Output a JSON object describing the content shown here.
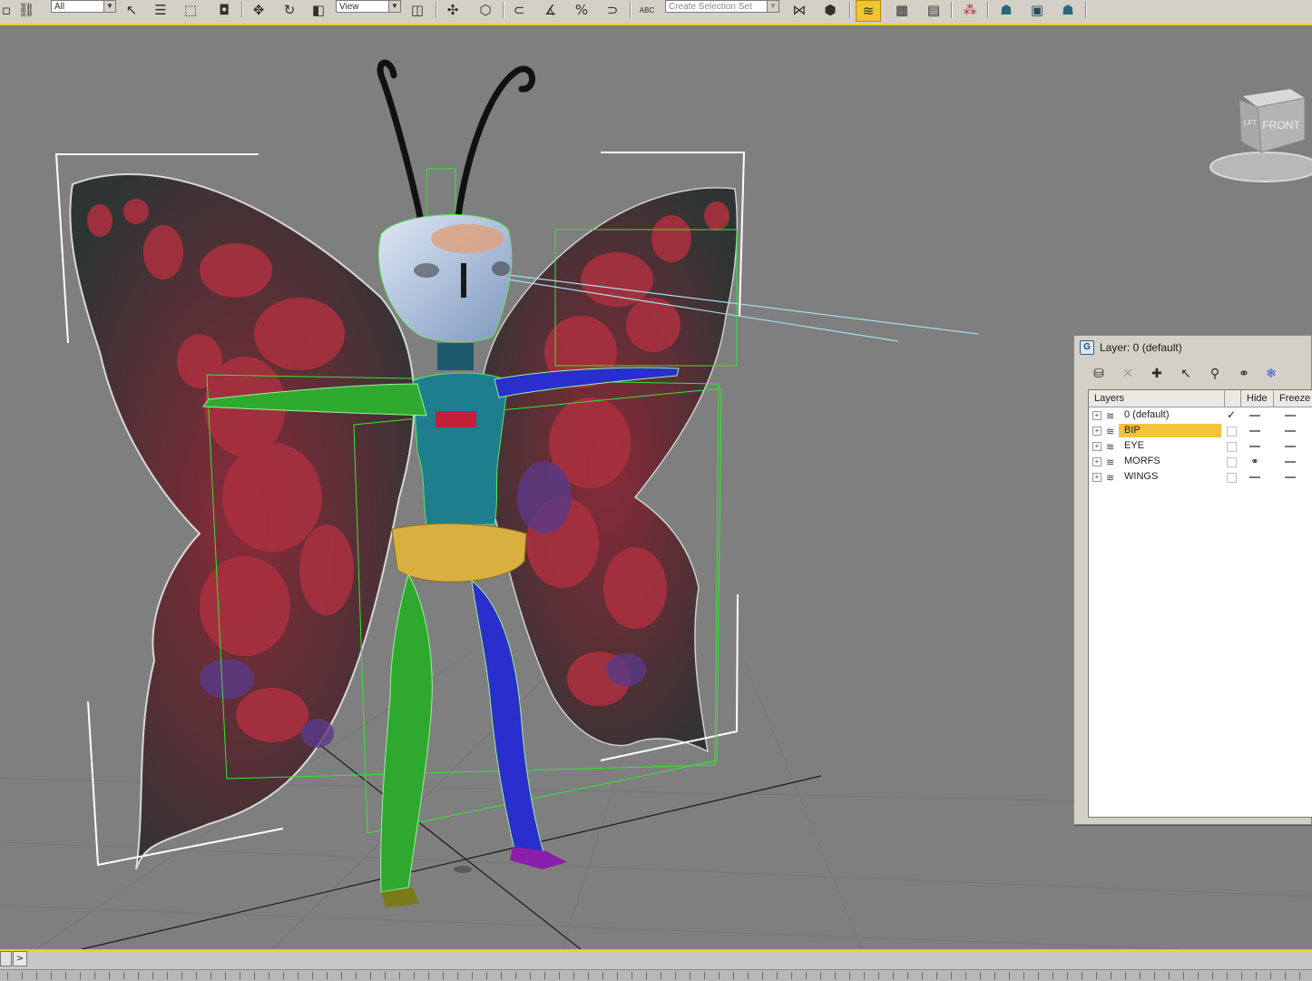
{
  "toolbar": {
    "selection_filter": "All",
    "reference_coord": "View",
    "named_selection": "Create Selection Set",
    "abc_label": "ABC",
    "icons": [
      "select-icon",
      "select-by-name-icon",
      "rect-region-icon",
      "window-crossing-icon",
      "move-icon",
      "rotate-icon",
      "scale-icon",
      "use-pivot-icon",
      "select-manipulate-icon",
      "snap-icon",
      "angle-snap-icon",
      "percent-snap-icon",
      "spinner-snap-icon",
      "edit-named-sets-icon",
      "mirror-icon",
      "align-icon",
      "layer-manager-icon",
      "graphite-ribbon-icon",
      "curve-editor-icon",
      "schematic-view-icon",
      "material-editor-icon",
      "render-setup-icon",
      "rendered-frame-icon",
      "render-icon"
    ]
  },
  "viewcube": {
    "left": "LFT",
    "front": "FRONT"
  },
  "layer_dialog": {
    "title": "Layer: 0 (default)",
    "app_icon": "G",
    "columns": {
      "layers": "Layers",
      "hide": "Hide",
      "freeze": "Freeze"
    },
    "layers": [
      {
        "name": "0 (default)",
        "current": true,
        "selected": false,
        "hidden": false
      },
      {
        "name": "BIP",
        "current": false,
        "selected": true,
        "hidden": false
      },
      {
        "name": "EYE",
        "current": false,
        "selected": false,
        "hidden": false
      },
      {
        "name": "MORFS",
        "current": false,
        "selected": false,
        "hidden": true
      },
      {
        "name": "WINGS",
        "current": false,
        "selected": false,
        "hidden": false
      }
    ]
  },
  "timeline": {
    "next_label": ">"
  },
  "colors": {
    "accent": "#e8d400",
    "selection": "#f3c33a",
    "viewport": "#7f7f7f"
  }
}
